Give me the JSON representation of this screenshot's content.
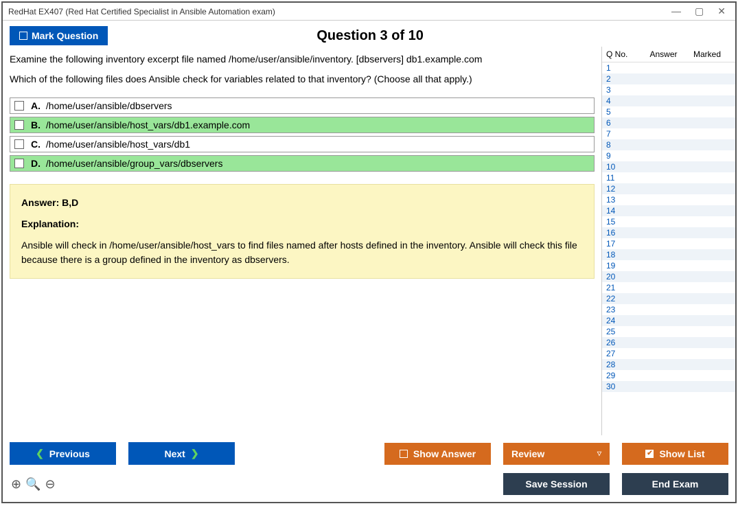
{
  "window": {
    "title": "RedHat EX407 (Red Hat Certified Specialist in Ansible Automation exam)"
  },
  "header": {
    "mark_label": "Mark Question",
    "question_counter": "Question 3 of 10"
  },
  "question": {
    "text_line1": "Examine the following inventory excerpt file named /home/user/ansible/inventory. [dbservers] db1.example.com",
    "text_line2": "Which of the following files does Ansible check for variables related to that inventory? (Choose all that apply.)",
    "options": [
      {
        "letter": "A.",
        "text": "/home/user/ansible/dbservers",
        "correct": false
      },
      {
        "letter": "B.",
        "text": "/home/user/ansible/host_vars/db1.example.com",
        "correct": true
      },
      {
        "letter": "C.",
        "text": "/home/user/ansible/host_vars/db1",
        "correct": false
      },
      {
        "letter": "D.",
        "text": "/home/user/ansible/group_vars/dbservers",
        "correct": true
      }
    ]
  },
  "answer_panel": {
    "answer_line": "Answer: B,D",
    "explanation_label": "Explanation:",
    "explanation_text": "Ansible will check in /home/user/ansible/host_vars to find files named after hosts defined in the inventory. Ansible will check this file because there is a group defined in the inventory as dbservers."
  },
  "sidebar": {
    "headers": {
      "qno": "Q No.",
      "answer": "Answer",
      "marked": "Marked"
    },
    "rows": [
      1,
      2,
      3,
      4,
      5,
      6,
      7,
      8,
      9,
      10,
      11,
      12,
      13,
      14,
      15,
      16,
      17,
      18,
      19,
      20,
      21,
      22,
      23,
      24,
      25,
      26,
      27,
      28,
      29,
      30
    ]
  },
  "footer": {
    "previous": "Previous",
    "next": "Next",
    "show_answer": "Show Answer",
    "review": "Review",
    "show_list": "Show List",
    "save_session": "Save Session",
    "end_exam": "End Exam"
  }
}
